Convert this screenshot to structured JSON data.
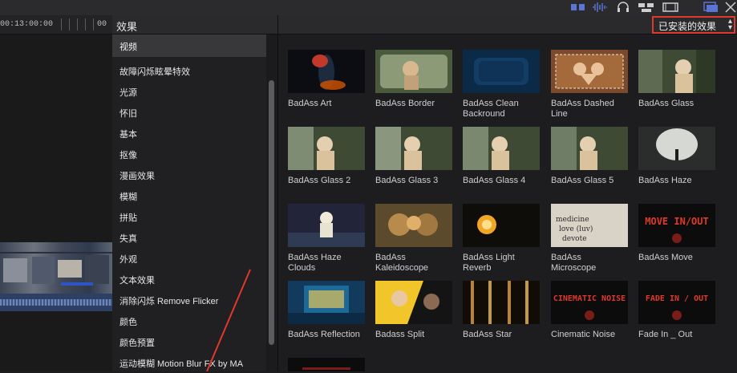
{
  "timeline": {
    "timecode_left": "00:13:00:00",
    "timecode_right": "00"
  },
  "effects_browser": {
    "title": "效果",
    "filter": "已安装的效果",
    "category_header": "视频",
    "categories": [
      "故障闪烁眩晕特效",
      "光源",
      "怀旧",
      "基本",
      "抠像",
      "漫画效果",
      "模糊",
      "拼贴",
      "失真",
      "外观",
      "文本效果",
      "消除闪烁 Remove Flicker",
      "颜色",
      "颜色预置",
      "运动模糊 Motion Blur FX by MA"
    ],
    "effects": [
      {
        "line1": "BadAss Art",
        "line2": ""
      },
      {
        "line1": "BadAss Border",
        "line2": ""
      },
      {
        "line1": "BadAss Clean",
        "line2": "Backround"
      },
      {
        "line1": "BadAss Dashed",
        "line2": "Line"
      },
      {
        "line1": "BadAss Glass",
        "line2": ""
      },
      {
        "line1": "BadAss Glass 2",
        "line2": ""
      },
      {
        "line1": "BadAss Glass 3",
        "line2": ""
      },
      {
        "line1": "BadAss Glass 4",
        "line2": ""
      },
      {
        "line1": "BadAss Glass 5",
        "line2": ""
      },
      {
        "line1": "BadAss Haze",
        "line2": ""
      },
      {
        "line1": "BadAss Haze",
        "line2": "Clouds"
      },
      {
        "line1": "BadAss",
        "line2": "Kaleidoscope"
      },
      {
        "line1": "BadAss Light",
        "line2": "Reverb"
      },
      {
        "line1": "BadAss",
        "line2": "Microscope"
      },
      {
        "line1": "BadAss Move",
        "line2": ""
      },
      {
        "line1": "BadAss Reflection",
        "line2": ""
      },
      {
        "line1": "Badass Split",
        "line2": ""
      },
      {
        "line1": "BadAss Star",
        "line2": ""
      },
      {
        "line1": "Cinematic Noise",
        "line2": ""
      },
      {
        "line1": "Fade In _ Out",
        "line2": ""
      }
    ],
    "thumb_text": {
      "move": "MOVE IN/OUT",
      "noise": "CINEMATIC NOISE",
      "fade": "FADE IN / OUT",
      "microscope": "medicine love (luv) devote"
    }
  },
  "colors": {
    "accent_red": "#e0382b",
    "panel_bg": "#1d1d1f",
    "selection_blue": "#3f5ab3"
  }
}
